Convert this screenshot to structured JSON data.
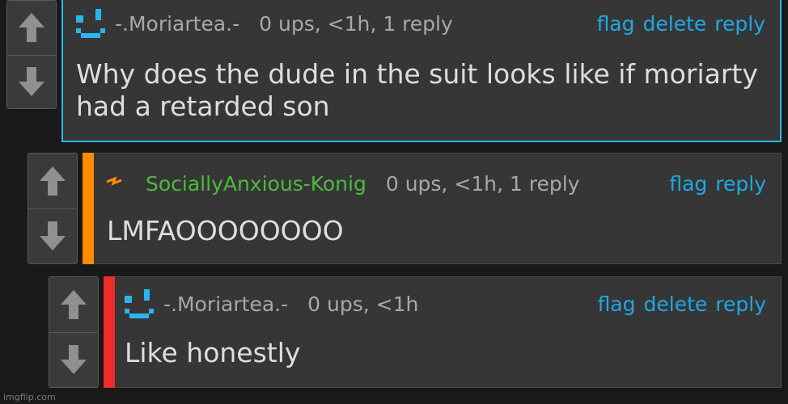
{
  "comments": [
    {
      "username": "-.Moriartea.-",
      "meta": "0 ups, <1h, 1 reply",
      "body": "Why does the dude in the suit looks like if moriarty had a retarded son",
      "actions": [
        "flag",
        "delete",
        "reply"
      ]
    },
    {
      "username": "SociallyAnxious-Konig",
      "meta": "0 ups, <1h, 1 reply",
      "body": "LMFAOOOOOOOO",
      "actions": [
        "flag",
        "reply"
      ]
    },
    {
      "username": "-.Moriartea.-",
      "meta": "0 ups, <1h",
      "body": "Like honestly",
      "actions": [
        "flag",
        "delete",
        "reply"
      ]
    }
  ],
  "colors": {
    "link": "#1fa8e6",
    "selected_border": "#29b6f0",
    "accent_orange": "#ff8c00",
    "accent_red": "#ef2b2b",
    "username_green": "#4cbb3c",
    "avatar_blue": "#2bb5ef"
  },
  "icons": {
    "upvote": "up-arrow-icon",
    "downvote": "down-arrow-icon",
    "avatar_1": "smiley-avatar-icon",
    "avatar_2": "lightning-avatar-icon"
  },
  "footer": "imgflip.com"
}
